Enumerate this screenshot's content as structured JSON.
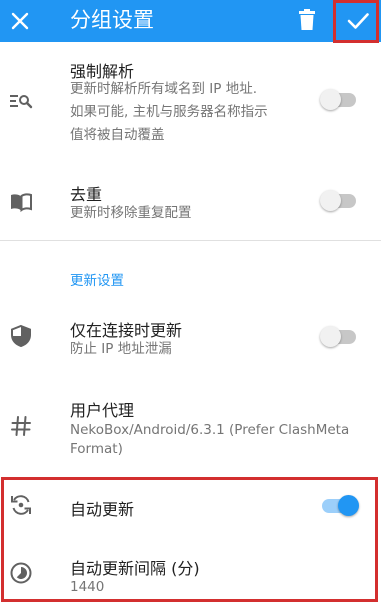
{
  "appbar": {
    "title": "分组设置",
    "bg": "#2196f3"
  },
  "settings": [
    {
      "key": "force_resolve",
      "title": "强制解析",
      "subtitle_lines": [
        "更新时解析所有域名到 IP 地址.",
        "如果可能, 主机与服务器名称指示",
        "值将被自动覆盖"
      ],
      "icon": "dns-search-icon",
      "switch": "off"
    },
    {
      "key": "dedupe",
      "title": "去重",
      "subtitle_lines": [
        "更新时移除重复配置"
      ],
      "icon": "book-open-icon",
      "switch": "off"
    }
  ],
  "section_header": "更新设置",
  "update_settings": [
    {
      "key": "update_when_connected",
      "title": "仅在连接时更新",
      "subtitle_lines": [
        "防止 IP 地址泄漏"
      ],
      "icon": "shield-icon",
      "switch": "off"
    },
    {
      "key": "user_agent",
      "title": "用户代理",
      "subtitle_lines": [
        "NekoBox/Android/6.3.1 (Prefer ClashMeta",
        "Format)"
      ],
      "icon": "hash-icon"
    },
    {
      "key": "auto_update",
      "title": "自动更新",
      "icon": "sync-icon",
      "switch": "on"
    },
    {
      "key": "auto_update_interval",
      "title": "自动更新间隔 (分)",
      "subtitle_lines": [
        "1440"
      ],
      "icon": "timelapse-icon"
    }
  ],
  "colors": {
    "accent": "#2196f3",
    "highlight": "#d32f2f",
    "text_secondary": "#757575"
  }
}
